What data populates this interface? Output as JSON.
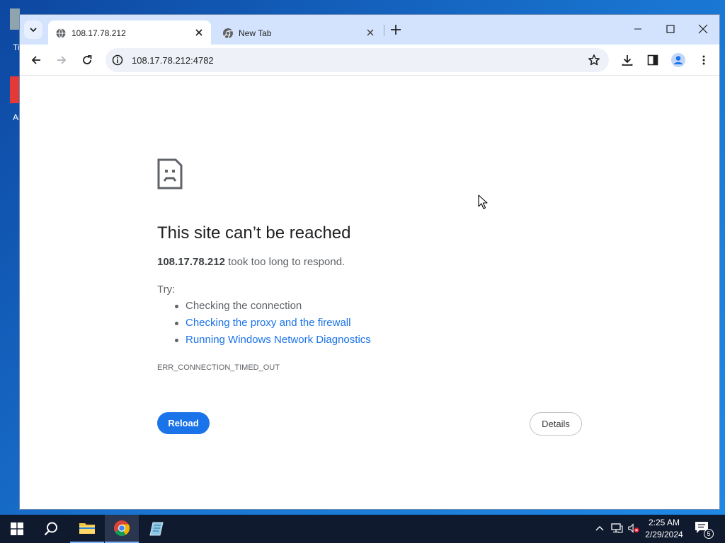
{
  "desktop": {
    "icons": [
      {
        "label": "Ti"
      },
      {
        "label": "Ar"
      }
    ]
  },
  "browser": {
    "tabs": [
      {
        "title": "108.17.78.212",
        "active": true,
        "icon": "globe-icon"
      },
      {
        "title": "New Tab",
        "active": false,
        "icon": "chrome-icon"
      }
    ],
    "address": {
      "url": "108.17.78.212:4782"
    }
  },
  "error_page": {
    "title": "This site can’t be reached",
    "host": "108.17.78.212",
    "description_suffix": " took too long to respond.",
    "try_label": "Try:",
    "suggestions": [
      {
        "text": "Checking the connection",
        "link": false
      },
      {
        "text": "Checking the proxy and the firewall",
        "link": true
      },
      {
        "text": "Running Windows Network Diagnostics",
        "link": true
      }
    ],
    "error_code": "ERR_CONNECTION_TIMED_OUT",
    "reload_label": "Reload",
    "details_label": "Details"
  },
  "taskbar": {
    "time": "2:25 AM",
    "date": "2/29/2024",
    "notification_count": "5"
  },
  "colors": {
    "accent": "#1a73e8",
    "tabstrip": "#d3e3fd",
    "taskbar": "#101a2e"
  }
}
